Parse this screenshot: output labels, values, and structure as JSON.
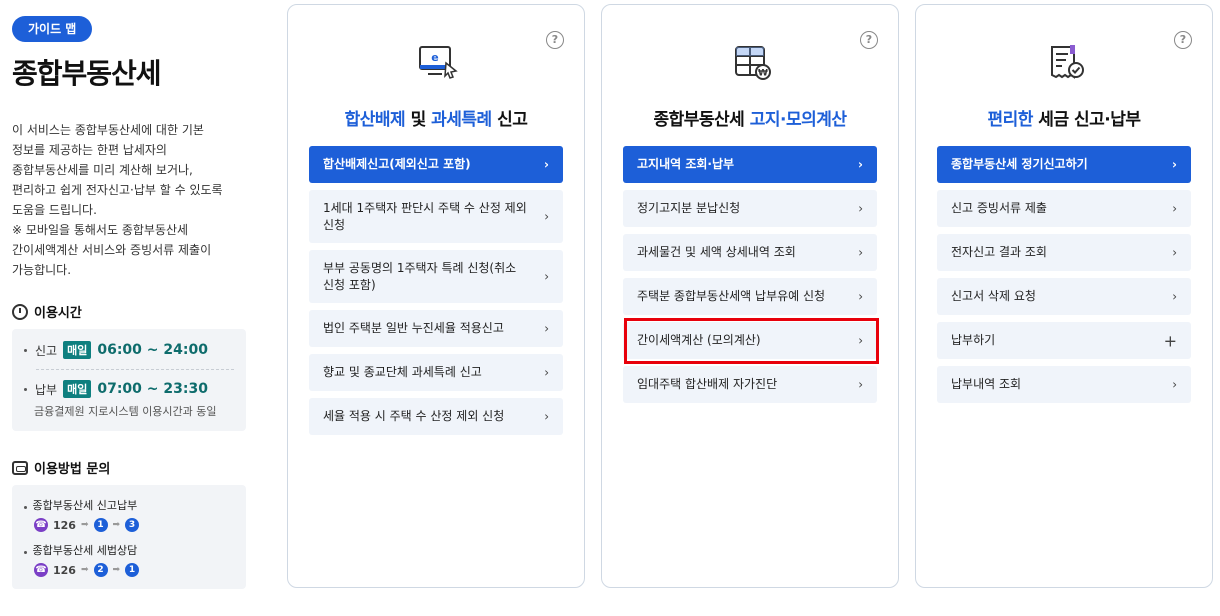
{
  "sidebar": {
    "guide_pill": "가이드 맵",
    "title": "종합부동산세",
    "description": [
      "이 서비스는 종합부동산세에 대한 기본",
      "정보를 제공하는 한편 납세자의",
      "종합부동산세를 미리 계산해 보거나,",
      "편리하고 쉽게 전자신고·납부 할 수 있도록",
      "도움을 드립니다.",
      "※ 모바일을 통해서도 종합부동산세",
      "간이세액계산 서비스와 증빙서류 제출이",
      "가능합니다."
    ],
    "time": {
      "title": "이용시간",
      "report_label": "신고",
      "report_badge": "매일",
      "report_value": "06:00 ~ 24:00",
      "pay_label": "납부",
      "pay_badge": "매일",
      "pay_value": "07:00 ~ 23:30",
      "note": "금융결제원 지로시스템 이용시간과 동일"
    },
    "inquiry": {
      "title": "이용방법 문의",
      "items": [
        {
          "label": "종합부동산세 신고납부",
          "tel": "126",
          "steps": [
            "1",
            "3"
          ]
        },
        {
          "label": "종합부동산세 세법상담",
          "tel": "126",
          "steps": [
            "2",
            "1"
          ]
        }
      ]
    }
  },
  "cards": [
    {
      "title_hl1": "합산배제",
      "title_mid": " 및 ",
      "title_hl2": "과세특례",
      "title_tail": " 신고",
      "icon": "e-monitor-icon",
      "items": [
        {
          "label": "합산배제신고(제외신고 포함)",
          "active": true
        },
        {
          "label": "1세대 1주택자 판단시 주택 수 산정 제외 신청"
        },
        {
          "label": "부부 공동명의 1주택자 특례 신청(취소 신청 포함)"
        },
        {
          "label": "법인 주택분 일반 누진세율 적용신고"
        },
        {
          "label": "향교 및 종교단체 과세특례 신고"
        },
        {
          "label": "세율 적용 시 주택 수 산정 제외 신청"
        }
      ]
    },
    {
      "title_pre": "종합부동산세 ",
      "title_hl": "고지·모의계산",
      "icon": "calculator-icon",
      "items": [
        {
          "label": "고지내역 조회·납부",
          "active": true
        },
        {
          "label": "정기고지분 분납신청"
        },
        {
          "label": "과세물건 및 세액 상세내역 조회"
        },
        {
          "label": "주택분 종합부동산세액 납부유예 신청"
        },
        {
          "label": "간이세액계산 (모의계산)"
        },
        {
          "label": "임대주택 합산배제 자가진단"
        }
      ]
    },
    {
      "title_hl": "편리한",
      "title_tail": " 세금 신고·납부",
      "icon": "receipt-check-icon",
      "items": [
        {
          "label": "종합부동산세 정기신고하기",
          "active": true
        },
        {
          "label": "신고 증빙서류 제출"
        },
        {
          "label": "전자신고 결과 조회"
        },
        {
          "label": "신고서 삭제 요청"
        },
        {
          "label": "납부하기",
          "expand": true
        },
        {
          "label": "납부내역 조회"
        }
      ]
    }
  ],
  "help_label": "?",
  "colors": {
    "accent": "#1d5fd8",
    "teal": "#0e7f7f",
    "highlight": "#e8000b"
  }
}
